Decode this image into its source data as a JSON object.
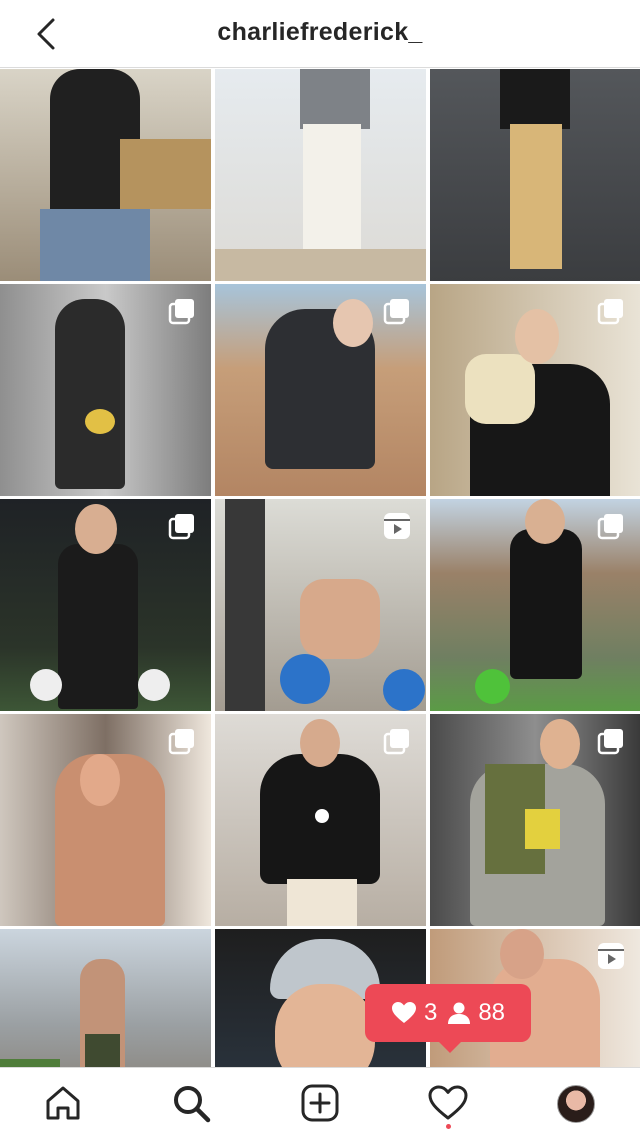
{
  "header": {
    "username": "charliefrederick_",
    "back_icon": "chevron-left-icon"
  },
  "grid": {
    "tiles": [
      {
        "badge": "none"
      },
      {
        "badge": "none"
      },
      {
        "badge": "none"
      },
      {
        "badge": "carousel"
      },
      {
        "badge": "carousel"
      },
      {
        "badge": "carousel"
      },
      {
        "badge": "carousel"
      },
      {
        "badge": "reel"
      },
      {
        "badge": "carousel"
      },
      {
        "badge": "carousel"
      },
      {
        "badge": "carousel"
      },
      {
        "badge": "carousel"
      },
      {
        "badge": "none"
      },
      {
        "badge": "none"
      },
      {
        "badge": "reel"
      }
    ]
  },
  "activity": {
    "likes": "3",
    "followers": "88",
    "color": "#ed4956"
  },
  "bottom_nav": {
    "items": [
      "home-icon",
      "search-icon",
      "new-post-icon",
      "activity-heart-icon",
      "profile-avatar"
    ]
  }
}
